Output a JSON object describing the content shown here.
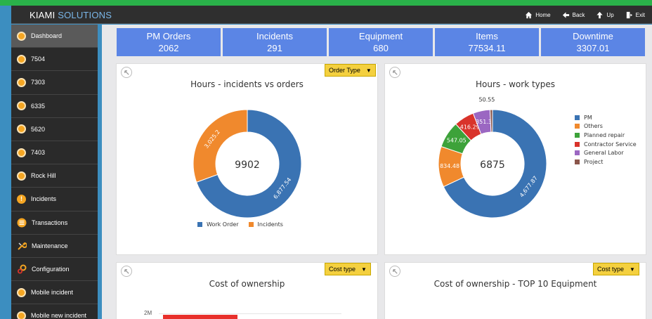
{
  "app": {
    "brand_primary": "KIAMI",
    "brand_secondary": "SOLUTIONS"
  },
  "topnav": [
    {
      "label": "Home",
      "icon": "home-icon"
    },
    {
      "label": "Back",
      "icon": "arrow-left-icon"
    },
    {
      "label": "Up",
      "icon": "arrow-up-icon"
    },
    {
      "label": "Exit",
      "icon": "exit-icon"
    }
  ],
  "sidebar": {
    "items": [
      {
        "label": "Dashboard",
        "icon": "dot",
        "active": true
      },
      {
        "label": "7504",
        "icon": "dot"
      },
      {
        "label": "7303",
        "icon": "dot"
      },
      {
        "label": "6335",
        "icon": "dot"
      },
      {
        "label": "5620",
        "icon": "dot"
      },
      {
        "label": "7403",
        "icon": "dot"
      },
      {
        "label": "Rock Hill",
        "icon": "dot"
      },
      {
        "label": "Incidents",
        "icon": "alert"
      },
      {
        "label": "Transactions",
        "icon": "list"
      },
      {
        "label": "Maintenance",
        "icon": "wrench"
      },
      {
        "label": "Configuration",
        "icon": "gears"
      },
      {
        "label": "Mobile incident",
        "icon": "dot"
      },
      {
        "label": "Mobile new incident",
        "icon": "dot"
      }
    ]
  },
  "kpis": [
    {
      "title": "PM Orders",
      "value": "2062"
    },
    {
      "title": "Incidents",
      "value": "291"
    },
    {
      "title": "Equipment",
      "value": "680"
    },
    {
      "title": "Items",
      "value": "77534.11"
    },
    {
      "title": "Downtime",
      "value": "3307.01"
    }
  ],
  "cards": {
    "c1": {
      "title": "Hours - incidents vs orders",
      "dropdown": "Order Type",
      "center": "9902"
    },
    "c2": {
      "title": "Hours - work types",
      "center": "6875"
    },
    "c3": {
      "title": "Cost of ownership",
      "dropdown": "Cost type",
      "ytick": "2M"
    },
    "c4": {
      "title": "Cost of ownership - TOP 10 Equipment",
      "dropdown": "Cost type"
    }
  },
  "colors": {
    "blue": "#3a73b3",
    "orange": "#f0892d",
    "green": "#3da23a",
    "red": "#d9332b",
    "purple": "#9b67c2",
    "brown": "#8b564b"
  },
  "chart_data": [
    {
      "type": "pie",
      "title": "Hours - incidents vs orders",
      "labels": [
        "Work Order",
        "Incidents"
      ],
      "values": [
        6877.54,
        3025.2
      ],
      "value_labels": [
        "6,877.54",
        "3,025.2"
      ],
      "colors": [
        "#3a73b3",
        "#f0892d"
      ],
      "legend": "bottom"
    },
    {
      "type": "pie",
      "title": "Hours - work types",
      "labels": [
        "PM",
        "Others",
        "Planned repair",
        "Contractor Service",
        "General Labor",
        "Project"
      ],
      "values": [
        4677.87,
        834.48,
        547.05,
        416.29,
        351.3,
        50.55
      ],
      "value_labels": [
        "4,677.87",
        "834.48",
        "547.05",
        "416.29",
        "351.3",
        "50.55"
      ],
      "colors": [
        "#3a73b3",
        "#f0892d",
        "#3da23a",
        "#d9332b",
        "#9b67c2",
        "#8b564b"
      ],
      "legend": "right"
    },
    {
      "type": "bar",
      "title": "Cost of ownership",
      "yticks": [
        "2M"
      ]
    }
  ]
}
